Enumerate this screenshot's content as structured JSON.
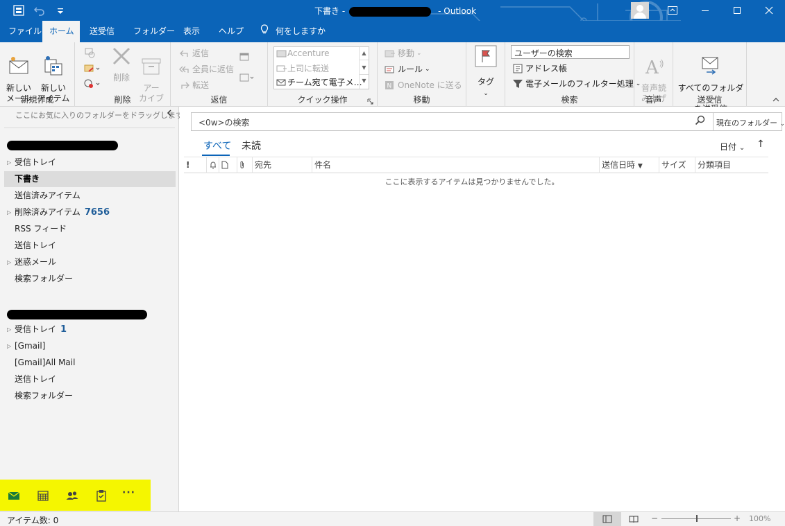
{
  "titlebar": {
    "folder_name": "下書き -",
    "app_name": "- Outlook",
    "colors": {
      "accent": "#0b64b8"
    }
  },
  "tabs": [
    {
      "label": "ファイル"
    },
    {
      "label": "ホーム",
      "active": true
    },
    {
      "label": "送受信"
    },
    {
      "label": "フォルダー"
    },
    {
      "label": "表示"
    },
    {
      "label": "ヘルプ"
    },
    {
      "label": "何をしますか"
    }
  ],
  "ribbon": {
    "new_group": {
      "label": "新規作成",
      "new_mail": "新しい\nメール",
      "new_items": "新しい\nアイテム"
    },
    "delete_group": {
      "label": "削除",
      "delete": "削除",
      "archive": "アー\nカイブ"
    },
    "reply_group": {
      "label": "返信",
      "reply": "返信",
      "reply_all": "全員に返信",
      "forward": "転送"
    },
    "quick_steps": {
      "label": "クイック操作",
      "items": [
        "Accenture",
        "上司に転送",
        "チーム宛て電子メ…"
      ]
    },
    "move_group": {
      "label": "移動",
      "move": "移動",
      "rules": "ルール",
      "onenote": "OneNote に送る"
    },
    "tags_group": {
      "label": "タグ"
    },
    "find_group": {
      "label": "検索",
      "search_people": "ユーザーの検索",
      "address_book": "アドレス帳",
      "filter_email": "電子メールのフィルター処理"
    },
    "speech_group": {
      "label": "音声",
      "read_aloud": "音声読\nみ上げ"
    },
    "send_receive_group": {
      "label": "送受信",
      "send_receive_all": "すべてのフォルダー\nを送受信"
    }
  },
  "folderpane": {
    "favorites_hint": "ここにお気に入りのフォルダーをドラッグします",
    "account1": [
      {
        "label": "受信トレイ",
        "expandable": true
      },
      {
        "label": "下書き",
        "selected": true
      },
      {
        "label": "送信済みアイテム"
      },
      {
        "label": "削除済みアイテム",
        "expandable": true,
        "count": "7656"
      },
      {
        "label": "RSS フィード"
      },
      {
        "label": "送信トレイ"
      },
      {
        "label": "迷惑メール",
        "expandable": true
      },
      {
        "label": "検索フォルダー"
      }
    ],
    "account2": [
      {
        "label": "受信トレイ",
        "expandable": true,
        "count": "1"
      },
      {
        "label": "[Gmail]",
        "expandable": true
      },
      {
        "label": "[Gmail]All Mail"
      },
      {
        "label": "送信トレイ"
      },
      {
        "label": "検索フォルダー"
      }
    ],
    "navbar": {
      "icons": [
        "mail-icon",
        "calendar-icon",
        "people-icon",
        "tasks-icon",
        "more-icon"
      ],
      "more_label": "···",
      "highlight_color": "#f5f600"
    }
  },
  "main": {
    "search_placeholder": "<0w>の検索",
    "search_scope": "現在のフォルダー",
    "filter_all": "すべて",
    "filter_unread": "未読",
    "sort_by": "日付",
    "sort_direction": "↑",
    "columns": [
      "!",
      "宛先",
      "件名",
      "送信日時",
      "サイズ",
      "分類項目"
    ],
    "empty_message": "ここに表示するアイテムは見つかりませんでした。"
  },
  "statusbar": {
    "item_count": "アイテム数: 0",
    "zoom": "100%",
    "zoom_minus": "−",
    "zoom_plus": "+"
  }
}
